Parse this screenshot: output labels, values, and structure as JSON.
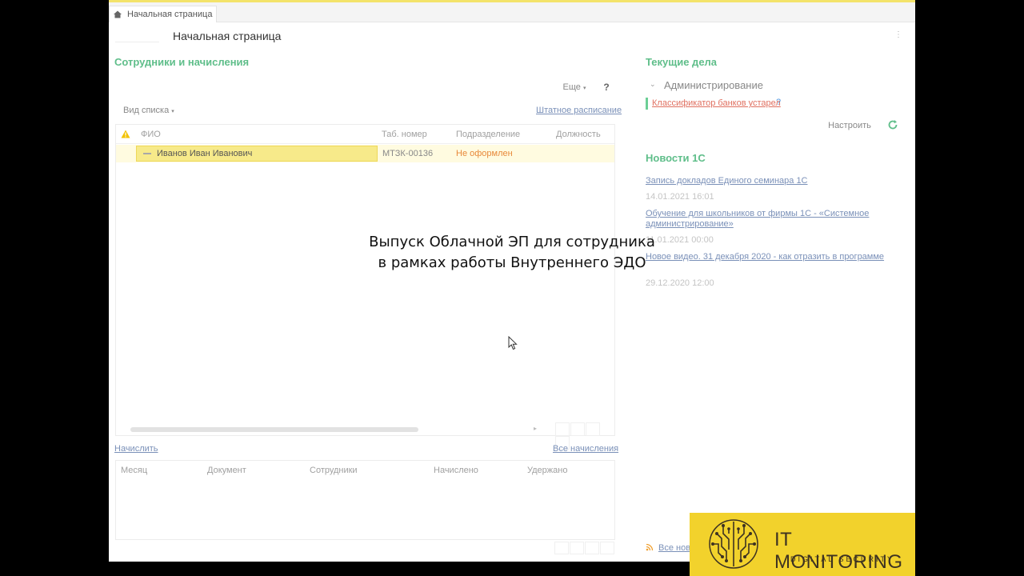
{
  "tabbar": {
    "home_tab_label": "Начальная страница"
  },
  "header": {
    "title": "Начальная страница",
    "menu_glyph": "⋮"
  },
  "employees": {
    "section_title": "Сотрудники и начисления",
    "more_label": "Еще",
    "help_label": "?",
    "view_label": "Вид списка",
    "staffing_link": "Штатное расписание",
    "columns": {
      "fio": "ФИО",
      "tab_number": "Таб. номер",
      "department": "Подразделение",
      "position": "Должность"
    },
    "rows": [
      {
        "fio": "Иванов Иван Иванович",
        "tab_number": "МТЗК-00136",
        "department": "Не оформлен",
        "position": ""
      }
    ]
  },
  "accruals": {
    "accrue_link": "Начислить",
    "all_link": "Все начисления",
    "columns": {
      "month": "Месяц",
      "document": "Документ",
      "employees": "Сотрудники",
      "accrued": "Начислено",
      "withheld": "Удержано"
    }
  },
  "tasks": {
    "section_title": "Текущие дела",
    "group_label": "Администрирование",
    "item_link": "Классификатор банков устарел",
    "item_help": "?",
    "configure_label": "Настроить"
  },
  "news": {
    "section_title": "Новости 1С",
    "items": [
      {
        "title": "Запись докладов Единого семинара 1С",
        "date": "14.01.2021 16:01"
      },
      {
        "title_line1": "Обучение для школьников от фирмы 1С - «Системное",
        "title_line2": "администрирование»",
        "date": "11.01.2021 00:00"
      },
      {
        "title": "Новое видео. 31 декабря 2020 - как отразить в программе",
        "date": "29.12.2020 12:00"
      }
    ],
    "all_link": "Все нов"
  },
  "overlay": {
    "line1": "Выпуск Облачной ЭП для сотрудника",
    "line2": "в рамках работы Внутреннего ЭДО"
  },
  "brand": {
    "name": "IT MONITORING",
    "tagline": "DIGITAL SECURITY"
  },
  "colors": {
    "section_green": "#5fbe8a",
    "selection_yellow": "#f7ea8a",
    "warning_orange": "#e8893a",
    "link_blue": "#7a90b8",
    "brand_yellow": "#f2d22c"
  }
}
